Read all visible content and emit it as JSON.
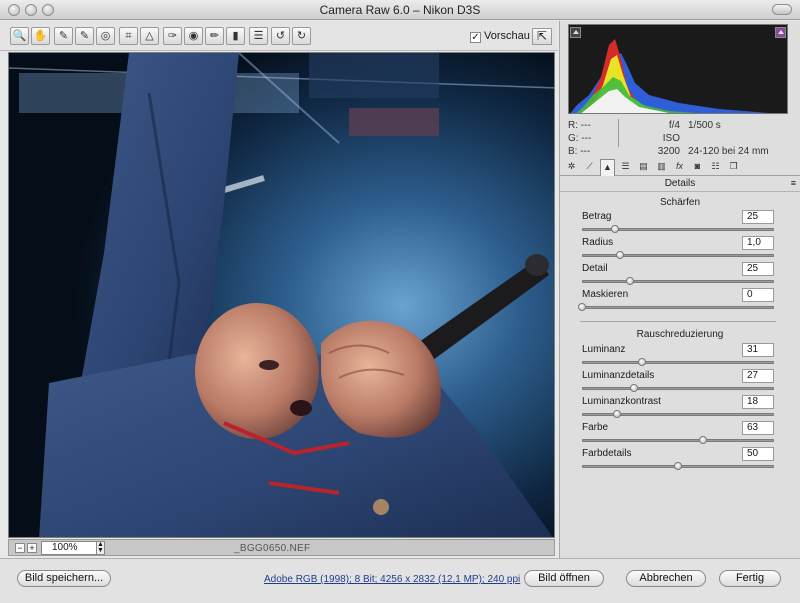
{
  "window": {
    "title": "Camera Raw 6.0 – Nikon D3S"
  },
  "toolbar": {
    "tools": [
      {
        "name": "zoom-tool-icon",
        "glyph": "🔍"
      },
      {
        "name": "hand-tool-icon",
        "glyph": "✋"
      },
      {
        "name": "white-balance-tool-icon",
        "glyph": "✎"
      },
      {
        "name": "color-sampler-tool-icon",
        "glyph": "✎"
      },
      {
        "name": "target-adjustment-tool-icon",
        "glyph": "◎"
      },
      {
        "name": "crop-tool-icon",
        "glyph": "⌗"
      },
      {
        "name": "straighten-tool-icon",
        "glyph": "△"
      },
      {
        "name": "spot-removal-tool-icon",
        "glyph": "✑"
      },
      {
        "name": "red-eye-tool-icon",
        "glyph": "◉"
      },
      {
        "name": "adjustment-brush-icon",
        "glyph": "✏"
      },
      {
        "name": "graduated-filter-icon",
        "glyph": "▮"
      },
      {
        "name": "preferences-icon",
        "glyph": "☰"
      },
      {
        "name": "rotate-left-icon",
        "glyph": "↺"
      },
      {
        "name": "rotate-right-icon",
        "glyph": "↻"
      }
    ],
    "preview_label": "Vorschau",
    "preview_checked": "✓"
  },
  "photo": {
    "zoom": "100%",
    "zoom_minus": "−",
    "zoom_plus": "+",
    "filename": "_BGG0650.NEF"
  },
  "histogram": {
    "readout": {
      "r": "R:  ---",
      "g": "G:  ---",
      "b": "B:  ---"
    },
    "camera": {
      "aperture": "f/4",
      "shutter": "1/500 s",
      "iso": "ISO 3200",
      "lens": "24-120 bei 24 mm"
    }
  },
  "panel": {
    "title": "Details",
    "menu_icon": "≡",
    "sections": {
      "sharpen": "Schärfen",
      "noise": "Rauschreduzierung"
    },
    "sharpen_controls": [
      {
        "label": "Betrag",
        "value": "25",
        "level": 0.17
      },
      {
        "label": "Radius",
        "value": "1,0",
        "level": 0.2
      },
      {
        "label": "Detail",
        "value": "25",
        "level": 0.25
      },
      {
        "label": "Maskieren",
        "value": "0",
        "level": 0.0
      }
    ],
    "noise_controls": [
      {
        "label": "Luminanz",
        "value": "31",
        "level": 0.31
      },
      {
        "label": "Luminanzdetails",
        "value": "27",
        "level": 0.27
      },
      {
        "label": "Luminanzkontrast",
        "value": "18",
        "level": 0.18
      },
      {
        "label": "Farbe",
        "value": "63",
        "level": 0.63
      },
      {
        "label": "Farbdetails",
        "value": "50",
        "level": 0.5
      }
    ]
  },
  "footer": {
    "save_label": "Bild speichern...",
    "info": "Adobe RGB (1998); 8 Bit; 4256 x 2832 (12,1 MP); 240 ppi",
    "open_label": "Bild öffnen",
    "cancel_label": "Abbrechen",
    "done_label": "Fertig"
  }
}
